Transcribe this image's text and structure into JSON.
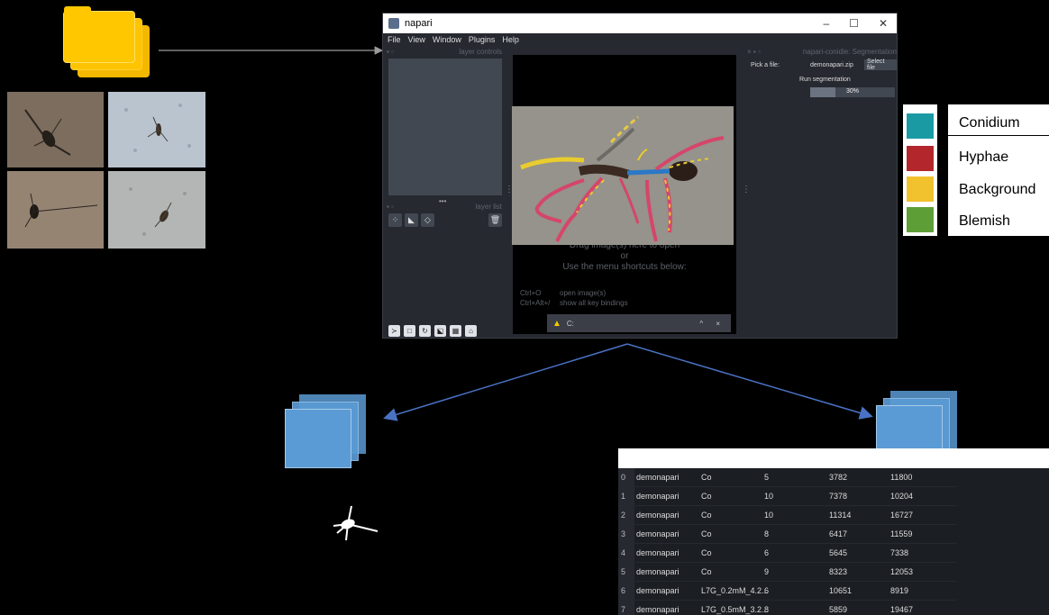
{
  "napari": {
    "title": "napari",
    "window_controls": [
      "–",
      "☐",
      "✕"
    ],
    "menu": [
      "File",
      "View",
      "Window",
      "Plugins",
      "Help"
    ],
    "layer_controls_label": "layer controls",
    "layer_list_label": "layer list",
    "canvas": {
      "line1": "Drag image(s) here to open",
      "line2": "or",
      "line3": "Use the menu shortcuts below:",
      "shortcut1_key": "Ctrl+O",
      "shortcut1_desc": "open image(s)",
      "shortcut2_key": "Ctrl+Alt+/",
      "shortcut2_desc": "show all key bindings"
    },
    "notification": "C:",
    "plugin": {
      "title": "napari-conidie: Segmentation",
      "pick_label": "Pick a file:",
      "file_name": "demonapari.zip",
      "select_button": "Select file",
      "run_label": "Run segmentation",
      "progress_text": "30%",
      "progress_value": 0.3
    }
  },
  "legend": {
    "items": [
      {
        "label": "Conidium",
        "color": "#1a9ba3"
      },
      {
        "label": "Hyphae",
        "color": "#b3262c"
      },
      {
        "label": "Background",
        "color": "#f2c12e"
      },
      {
        "label": "Blemish",
        "color": "#5e9e37"
      }
    ]
  },
  "table": {
    "rows": [
      {
        "idx": "0",
        "name": "demonapari",
        "cls": "Co",
        "n": "5",
        "a": "3782",
        "b": "11800"
      },
      {
        "idx": "1",
        "name": "demonapari",
        "cls": "Co",
        "n": "10",
        "a": "7378",
        "b": "10204"
      },
      {
        "idx": "2",
        "name": "demonapari",
        "cls": "Co",
        "n": "10",
        "a": "11314",
        "b": "16727"
      },
      {
        "idx": "3",
        "name": "demonapari",
        "cls": "Co",
        "n": "8",
        "a": "6417",
        "b": "11559"
      },
      {
        "idx": "4",
        "name": "demonapari",
        "cls": "Co",
        "n": "6",
        "a": "5645",
        "b": "7338"
      },
      {
        "idx": "5",
        "name": "demonapari",
        "cls": "Co",
        "n": "9",
        "a": "8323",
        "b": "12053"
      },
      {
        "idx": "6",
        "name": "demonapari",
        "cls": "L7G_0.2mM_4.2...",
        "n": "6",
        "a": "10651",
        "b": "8919"
      },
      {
        "idx": "7",
        "name": "demonapari",
        "cls": "L7G_0.5mM_3.2...",
        "n": "8",
        "a": "5859",
        "b": "19467"
      }
    ]
  }
}
